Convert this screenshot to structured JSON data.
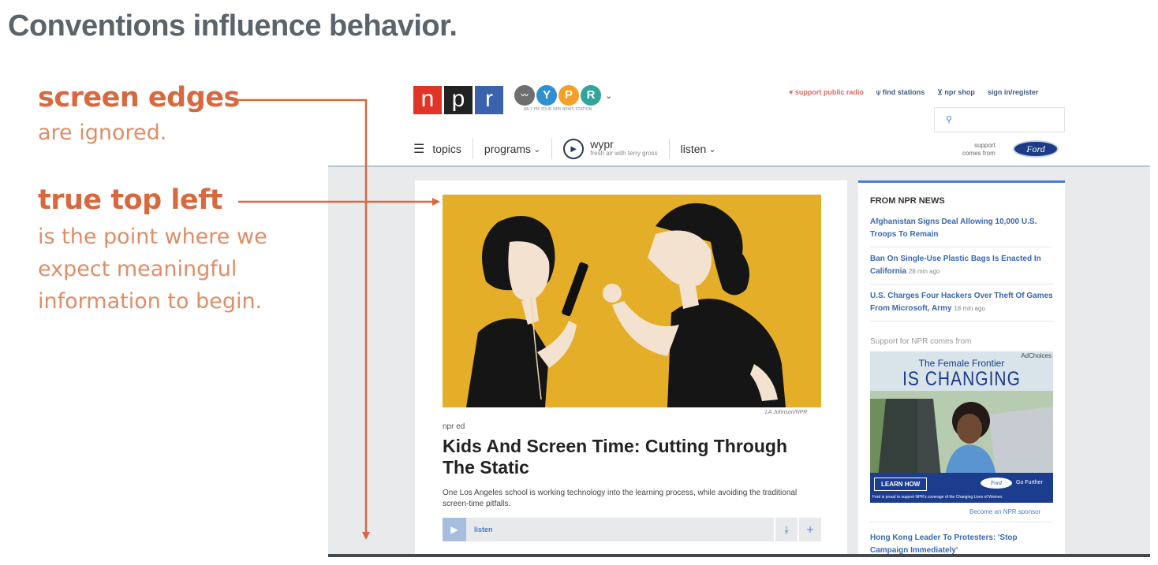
{
  "slide": {
    "title": "Conventions influence behavior.",
    "point1": {
      "heading": "screen edges",
      "text": "are ignored."
    },
    "point2": {
      "heading": "true top left",
      "lines": [
        "is the point where we",
        "expect meaningful",
        "information to begin."
      ]
    }
  },
  "colors": {
    "accent": "#d8693f",
    "npr_red": "#e03526",
    "npr_black": "#222222",
    "npr_blue": "#3a62ad",
    "link_blue": "#3a67b2",
    "hero_yellow": "#e5ae28"
  },
  "npr": {
    "logo_letters": [
      "n",
      "p",
      "r"
    ],
    "station_letters": [
      "Y",
      "P",
      "R"
    ],
    "station_tag": "88.1 FM YOUR NPR NEWS STATION",
    "top_links": [
      "support public radio",
      "find stations",
      "npr shop",
      "sign in/register"
    ],
    "nav": {
      "topics": "topics",
      "programs": "programs",
      "program_name": "wypr",
      "program_sub": "fresh air with terry gross",
      "listen": "listen"
    },
    "sponsor_line1": "support",
    "sponsor_line2": "comes from",
    "ford": "Ford"
  },
  "story": {
    "credit": "LA Johnson/NPR",
    "slug": "npr ed",
    "headline": "Kids And Screen Time: Cutting Through The Static",
    "teaser": "One Los Angeles school is working technology into the learning process, while avoiding the traditional screen-time pitfalls.",
    "listen": "listen"
  },
  "sidebar": {
    "heading": "FROM NPR NEWS",
    "stories": [
      {
        "title": "Afghanistan Signs Deal Allowing 10,000 U.S. Troops To Remain",
        "ago": ""
      },
      {
        "title": "Ban On Single-Use Plastic Bags Is Enacted In California",
        "ago": "28 min ago"
      },
      {
        "title": "U.S. Charges Four Hackers Over Theft Of Games From Microsoft, Army",
        "ago": "18 min ago"
      }
    ],
    "support_label": "Support for NPR comes from",
    "ad": {
      "choices": "AdChoices",
      "line1": "The Female Frontier",
      "line2": "IS CHANGING",
      "button": "LEARN HOW",
      "ford": "Ford",
      "go_further": "Go Further",
      "fine_print": "Ford is proud to support NPR's coverage of the Changing Lives of Women."
    },
    "become_sponsor": "Become an NPR sponsor",
    "last_story": "Hong Kong Leader To Protesters: 'Stop Campaign Immediately'"
  }
}
